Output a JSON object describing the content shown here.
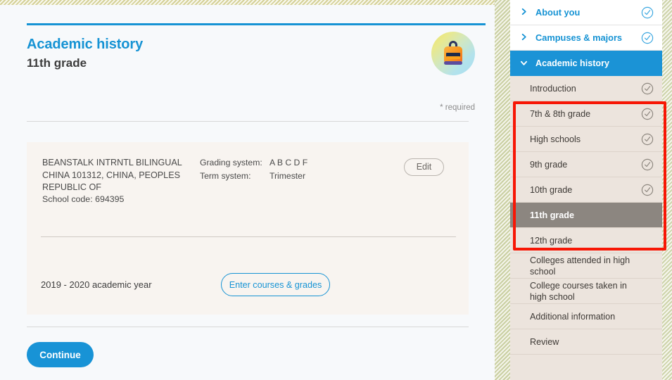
{
  "theme": {
    "accent_blue": "#1693d4",
    "selected_grey": "#8c8680",
    "card_bg": "#f8f4f0",
    "sidebar_bg": "#ece4dd",
    "highlight_red": "#f71605"
  },
  "header": {
    "title": "Academic history",
    "subtitle": "11th grade",
    "required_note": "* required",
    "art_icon": "backpack-icon"
  },
  "school_card": {
    "school_name": "BEANSTALK INTRNTL BILINGUAL CHINA 101312, CHINA, PEOPLES REPUBLIC OF",
    "school_code": "School code: 694395",
    "grading_label": "Grading system:",
    "grading_value": "A B C D F",
    "term_label": "Term system:",
    "term_value": "Trimester",
    "edit_label": "Edit",
    "academic_year": "2019 - 2020 academic year",
    "enter_courses_label": "Enter courses & grades"
  },
  "footer": {
    "continue_label": "Continue"
  },
  "sidebar": {
    "items": [
      {
        "label": "About you",
        "type": "top",
        "icon": "chevron-right-icon",
        "check": "check-circle-blue-icon"
      },
      {
        "label": "Campuses & majors",
        "type": "top",
        "icon": "chevron-right-icon",
        "check": "check-circle-blue-icon"
      },
      {
        "label": "Academic history",
        "type": "expanded",
        "icon": "chevron-down-icon",
        "check": "none"
      },
      {
        "label": "Introduction",
        "type": "sub",
        "icon": "none",
        "check": "check-circle-grey-icon"
      },
      {
        "label": "7th & 8th grade",
        "type": "sub",
        "icon": "none",
        "check": "check-circle-grey-icon"
      },
      {
        "label": "High schools",
        "type": "sub",
        "icon": "none",
        "check": "check-circle-grey-icon"
      },
      {
        "label": "9th grade",
        "type": "sub",
        "icon": "none",
        "check": "check-circle-grey-icon"
      },
      {
        "label": "10th grade",
        "type": "sub",
        "icon": "none",
        "check": "check-circle-grey-icon"
      },
      {
        "label": "11th grade",
        "type": "sub-selected",
        "icon": "none",
        "check": "none"
      },
      {
        "label": "12th grade",
        "type": "sub",
        "icon": "none",
        "check": "none"
      },
      {
        "label": "Colleges attended in high school",
        "type": "sub",
        "icon": "none",
        "check": "none"
      },
      {
        "label": "College courses taken in high school",
        "type": "sub",
        "icon": "none",
        "check": "none"
      },
      {
        "label": "Additional information",
        "type": "sub",
        "icon": "none",
        "check": "none"
      },
      {
        "label": "Review",
        "type": "sub",
        "icon": "none",
        "check": "none"
      }
    ]
  },
  "annotation": {
    "highlight_label": "red-highlight-rectangle"
  }
}
